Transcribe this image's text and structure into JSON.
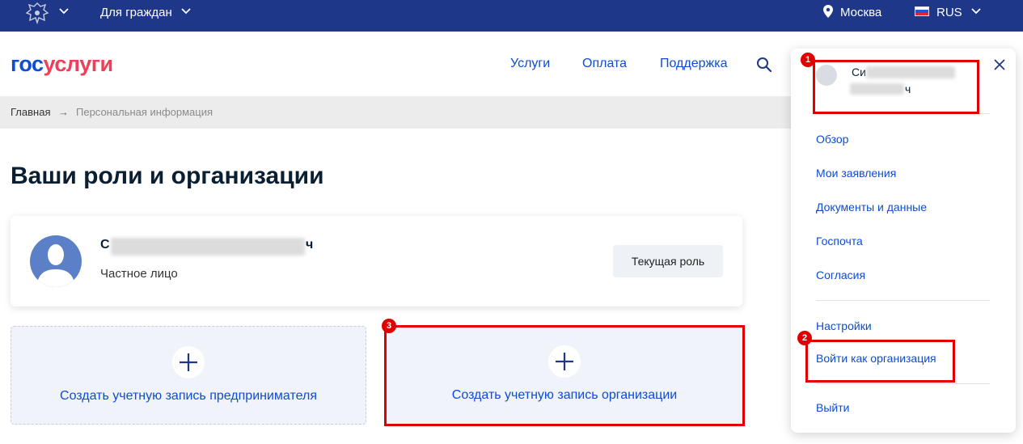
{
  "topbar": {
    "citizens_label": "Для граждан",
    "city": "Москва",
    "language": "RUS",
    "bg_color": "#1f3788"
  },
  "header": {
    "logo_part1": "гос",
    "logo_part2": "услуги",
    "nav": [
      "Услуги",
      "Оплата",
      "Поддержка"
    ],
    "search_icon": "search-icon"
  },
  "breadcrumb": {
    "home": "Главная",
    "separator": "→",
    "current": "Персональная информация"
  },
  "page": {
    "title": "Ваши роли и организации"
  },
  "profile_card": {
    "name_start": "С",
    "name_end": "ч",
    "role": "Частное лицо",
    "current_role_button": "Текущая роль"
  },
  "create": {
    "entrepreneur": "Создать учетную запись предпринимателя",
    "organization": "Создать учетную запись организации"
  },
  "menu": {
    "user_name_start": "Си",
    "user_name_end": "ч",
    "items_top": [
      "Обзор",
      "Мои заявления",
      "Документы и данные",
      "Госпочта",
      "Согласия"
    ],
    "settings": "Настройки",
    "login_as_org": "Войти как организация",
    "logout": "Выйти"
  },
  "annotations": {
    "badges": [
      "1",
      "2",
      "3"
    ],
    "color": "#e00000"
  },
  "colors": {
    "link": "#0d4cd3",
    "logo_red": "#ee3f58"
  }
}
